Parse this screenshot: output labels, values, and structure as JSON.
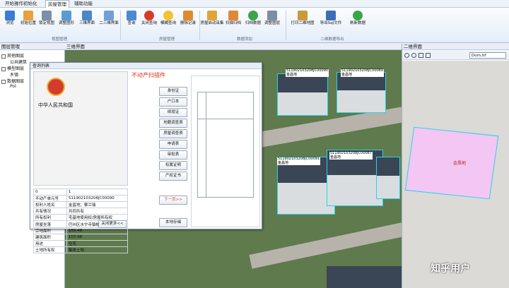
{
  "tabs": [
    "开始操作",
    "初始化",
    "房屋管理",
    "辅助功能"
  ],
  "ribbon": {
    "buttons": [
      "浏览",
      "初始位置",
      "锁定视图",
      "调整图形",
      "三维界面",
      "二三维界面",
      "查询",
      "关闭查询",
      "模糊查询",
      "删除记录",
      "房屋启动采集",
      "扫描归档",
      "归档数据",
      "调整图层",
      "打印二维地图",
      "导出Sql文件",
      "刷新数据"
    ],
    "groups": [
      "视图管理",
      "房屋管理",
      "数据添加",
      "二维数据导出"
    ]
  },
  "left_panel": {
    "title": "图层管理",
    "items": [
      "其他图层",
      "公共建筑",
      "模型图层",
      "乡镇",
      "数据图层",
      "Pol"
    ]
  },
  "map_panel": {
    "title": "三维界面"
  },
  "right_panel": {
    "title": "二维界面",
    "layer_select": "Dom.tif",
    "parcel_label": "金昌地"
  },
  "dialog": {
    "title": "查询列表",
    "subtitle": "不动产扫描件",
    "country": "中华人民共和国",
    "doc_buttons": [
      "身份证",
      "户口本",
      "续增证",
      "地籍调查表",
      "房屋调查表",
      "申请表",
      "审批表",
      "权属证明",
      "产权证书"
    ],
    "next_button": "下一页>>",
    "save_button": "本地存储",
    "close_button": "关闭更多<<",
    "table": [
      [
        "0",
        "1"
      ],
      [
        "不动产单元号",
        "511902103208JC00090"
      ],
      [
        "权利人姓名",
        "金昌地；蔡兰瑞"
      ],
      [
        "共有情况",
        "共同共有"
      ],
      [
        "所有权利",
        "宅基地使用权/房屋所有权"
      ],
      [
        "房屋坐落",
        "巴州区水宁寺镇楼桥村1社"
      ],
      [
        "宗地面积",
        "189.48"
      ],
      [
        "建筑面积",
        "103.98"
      ],
      [
        "用途",
        "住宅"
      ],
      [
        "土地所有权",
        "集体土地"
      ]
    ]
  },
  "map_labels": [
    "511902103208JC00090\n金昌地",
    "511902103208JC00089\n金昌地",
    "511902103208JC00091\n金昌地",
    "511902103208JC00087\n金昌地"
  ],
  "watermark": "知乎用户",
  "colors": {
    "highlight_cyan": "#27d4e8",
    "parcel_pink": "#f4c6f4",
    "title_red": "#d9301e"
  }
}
